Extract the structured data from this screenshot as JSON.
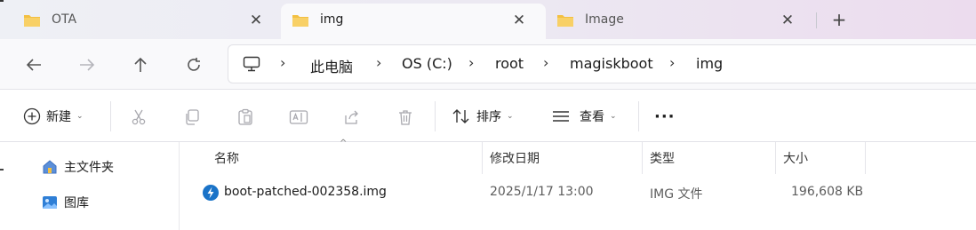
{
  "tabs": [
    {
      "label": "OTA",
      "active": false
    },
    {
      "label": "img",
      "active": true
    },
    {
      "label": "Image",
      "active": false
    }
  ],
  "tab_close_glyph": "✕",
  "new_tab_glyph": "+",
  "breadcrumb": [
    "此电脑",
    "OS (C:)",
    "root",
    "magiskboot",
    "img"
  ],
  "toolbar": {
    "new_label": "新建",
    "sort_label": "排序",
    "view_label": "查看",
    "more_glyph": "···"
  },
  "sidebar": {
    "items": [
      {
        "label": "主文件夹",
        "icon": "home-icon"
      },
      {
        "label": "图库",
        "icon": "gallery-icon"
      }
    ]
  },
  "table": {
    "columns": [
      "名称",
      "修改日期",
      "类型",
      "大小"
    ],
    "rows": [
      {
        "name": "boot-patched-002358.img",
        "modified": "2025/1/17 13:00",
        "type": "IMG 文件",
        "size": "196,608 KB",
        "icon": "magisk-file-icon"
      }
    ]
  },
  "colors": {
    "folder_yellow": "#f3c042",
    "accent_blue": "#1a73c8",
    "tab_active_bg": "#f9f9fb"
  }
}
